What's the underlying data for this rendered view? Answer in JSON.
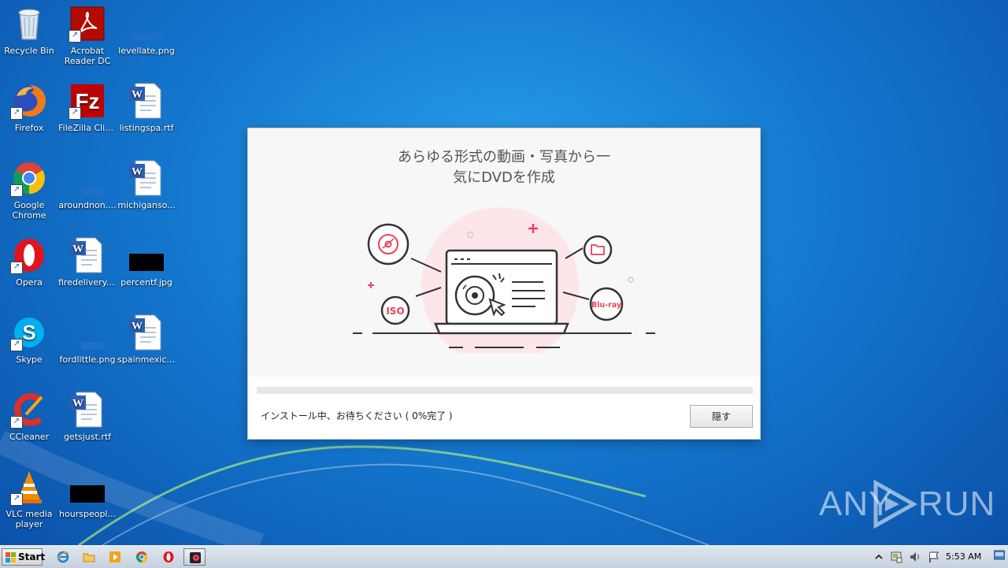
{
  "desktop_icons": [
    {
      "label": "Recycle Bin"
    },
    {
      "label": "Acrobat Reader DC"
    },
    {
      "label": "levellate.png"
    },
    {
      "label": "Firefox"
    },
    {
      "label": "FileZilla Client"
    },
    {
      "label": "listingspa.rtf"
    },
    {
      "label": "Google Chrome"
    },
    {
      "label": "aroundnon...."
    },
    {
      "label": "michiganso..."
    },
    {
      "label": "Opera"
    },
    {
      "label": "firedelivery.rtf"
    },
    {
      "label": "percentf.jpg"
    },
    {
      "label": "Skype"
    },
    {
      "label": "fordlittle.png"
    },
    {
      "label": "spainmexico..."
    },
    {
      "label": "CCleaner"
    },
    {
      "label": "getsjust.rtf"
    },
    {
      "label": "VLC media player"
    },
    {
      "label": "hourspeopl..."
    }
  ],
  "installer": {
    "title_line1": "あらゆる形式の動画・写真から一",
    "title_line2": "気にDVDを作成",
    "illustration": {
      "iso_label": "ISO",
      "bluray_label": "Blu-ray"
    },
    "progress": 0,
    "status_text": "インストール中、お待ちください ( 0%完了 )",
    "hide_button_label": "隠す",
    "accent_color": "#e9435a"
  },
  "watermark": {
    "text_left": "ANY",
    "text_right": "RUN"
  },
  "taskbar": {
    "start_label": "Start",
    "apps": [
      "ie-icon",
      "explorer-icon",
      "media-player-icon",
      "chrome-icon",
      "opera-icon",
      "dvd-creator-icon"
    ],
    "clock": "5:53 AM"
  }
}
